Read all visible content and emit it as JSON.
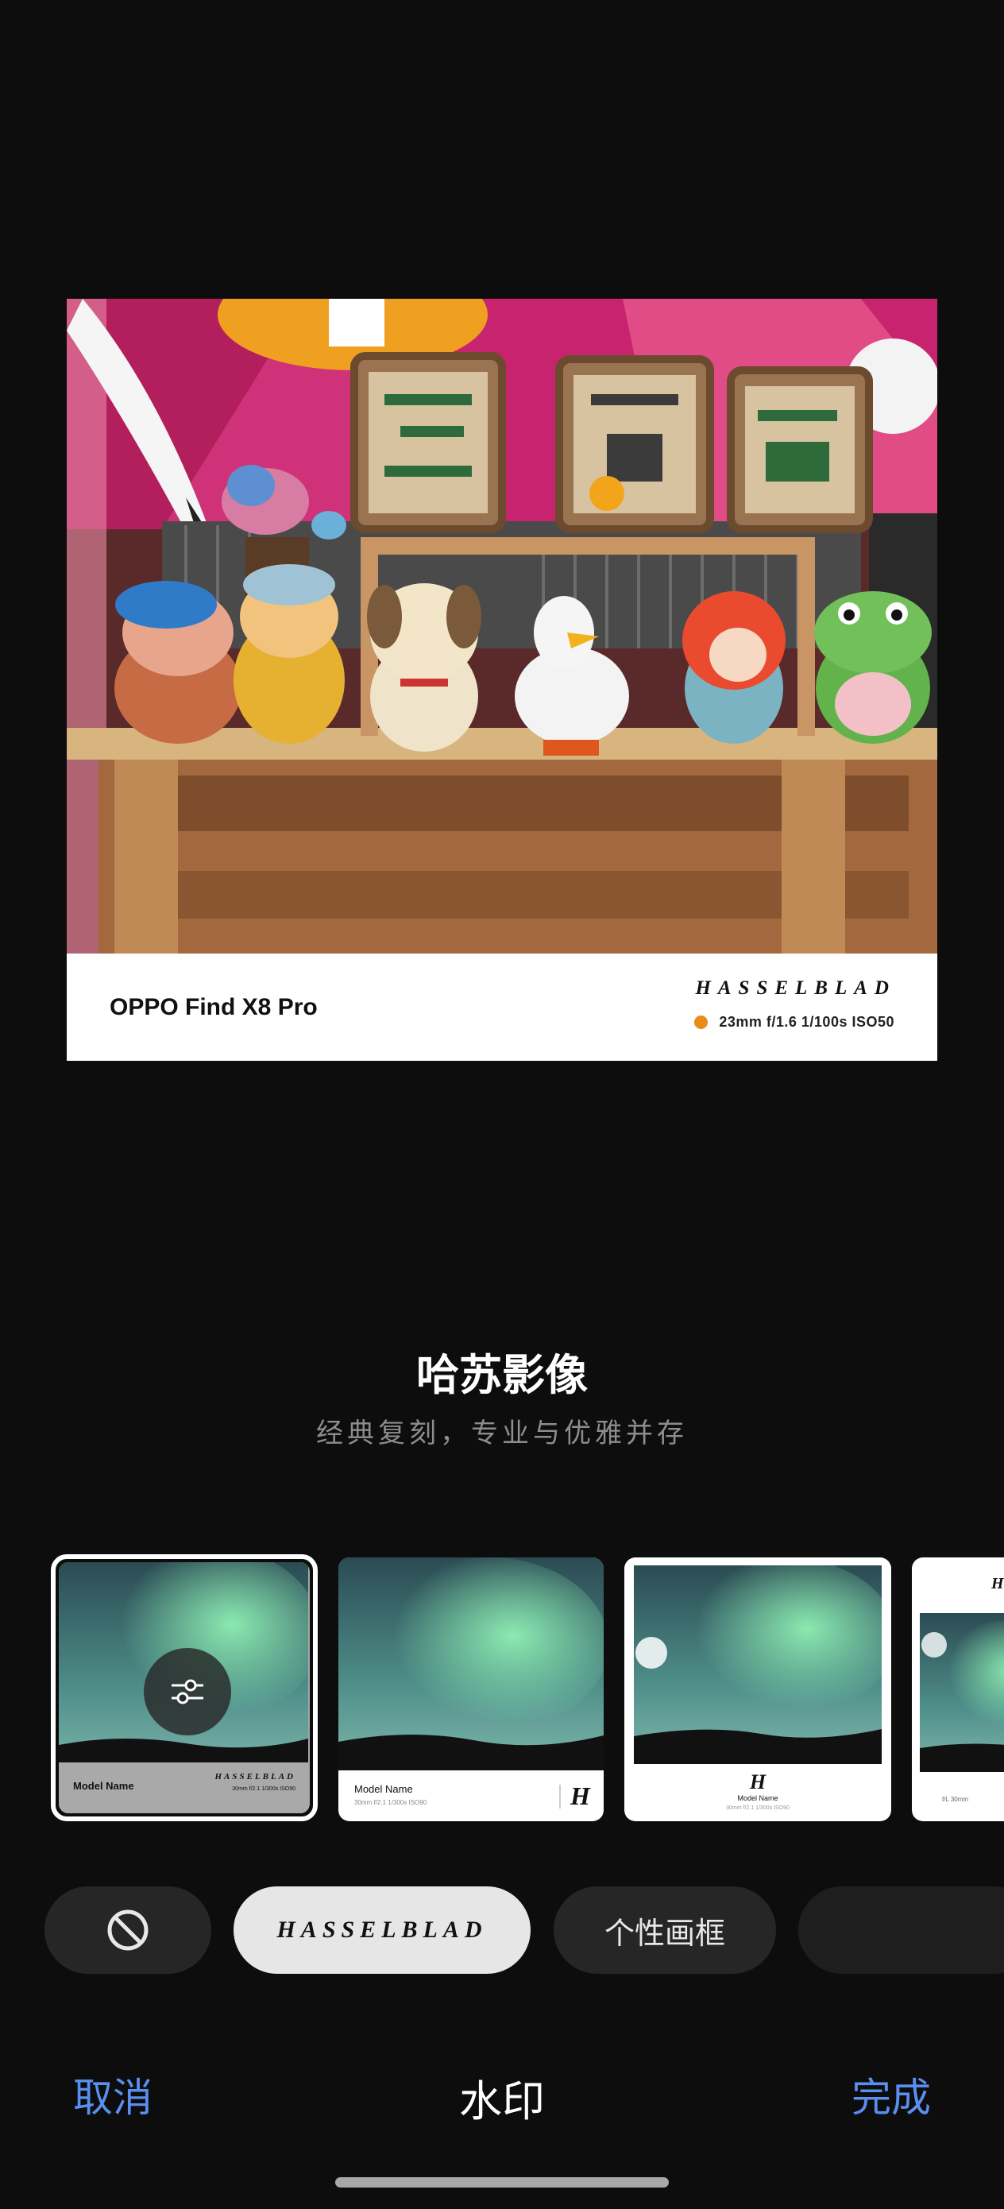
{
  "preview": {
    "model_name": "OPPO Find X8 Pro",
    "brand": "HASSELBLAD",
    "params": "23mm  f/1.6  1/100s  ISO50",
    "dot_color": "#e98a1a"
  },
  "style": {
    "title": "哈苏影像",
    "subtitle": "经典复刻，专业与优雅并存"
  },
  "templates": [
    {
      "model": "Model Name",
      "brand": "HASSELBLAD",
      "params": "30mm  f/2.1  1/300s  ISO90",
      "selected": true,
      "icon": "sliders-icon"
    },
    {
      "model": "Model Name",
      "params": "30mm  f/2.1  1/300s  ISO90",
      "logo": "H"
    },
    {
      "logo": "H",
      "model": "Model Name",
      "params": "30mm  f/2.1  1/300s  ISO90"
    },
    {
      "logo": "H",
      "params": "f/L  30mm"
    }
  ],
  "chips": {
    "none_icon": "no-entry-icon",
    "hasselblad": "HASSELBLAD",
    "frame": "个性画框"
  },
  "bottom": {
    "cancel": "取消",
    "title": "水印",
    "done": "完成"
  },
  "colors": {
    "accent": "#5a8ff0",
    "background": "#0d0d0d"
  }
}
